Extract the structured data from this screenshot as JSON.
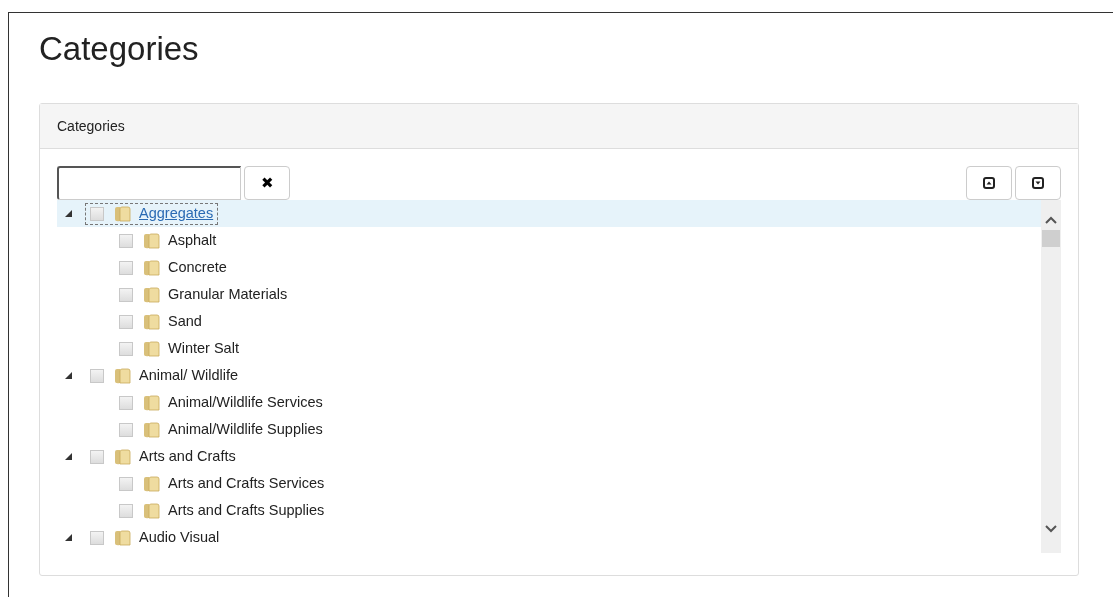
{
  "page": {
    "title": "Categories"
  },
  "panel": {
    "title": "Categories"
  },
  "search": {
    "clear_label": "✖"
  },
  "tree": [
    {
      "label": "Aggregates",
      "expanded": true,
      "checked": false,
      "selected": true,
      "children": [
        {
          "label": "Asphalt",
          "checked": false,
          "selected": false
        },
        {
          "label": "Concrete",
          "checked": false,
          "selected": false
        },
        {
          "label": "Granular Materials",
          "checked": false,
          "selected": false
        },
        {
          "label": "Sand",
          "checked": false,
          "selected": false
        },
        {
          "label": "Winter Salt",
          "checked": false,
          "selected": false
        }
      ]
    },
    {
      "label": "Animal/ Wildlife",
      "expanded": true,
      "checked": false,
      "selected": false,
      "children": [
        {
          "label": "Animal/Wildlife Services",
          "checked": false,
          "selected": false
        },
        {
          "label": "Animal/Wildlife Supplies",
          "checked": false,
          "selected": false
        }
      ]
    },
    {
      "label": "Arts and Crafts",
      "expanded": true,
      "checked": false,
      "selected": false,
      "children": [
        {
          "label": "Arts and Crafts Services",
          "checked": false,
          "selected": false
        },
        {
          "label": "Arts and Crafts Supplies",
          "checked": false,
          "selected": false
        }
      ]
    },
    {
      "label": "Audio Visual",
      "expanded": true,
      "checked": false,
      "selected": false
    }
  ]
}
